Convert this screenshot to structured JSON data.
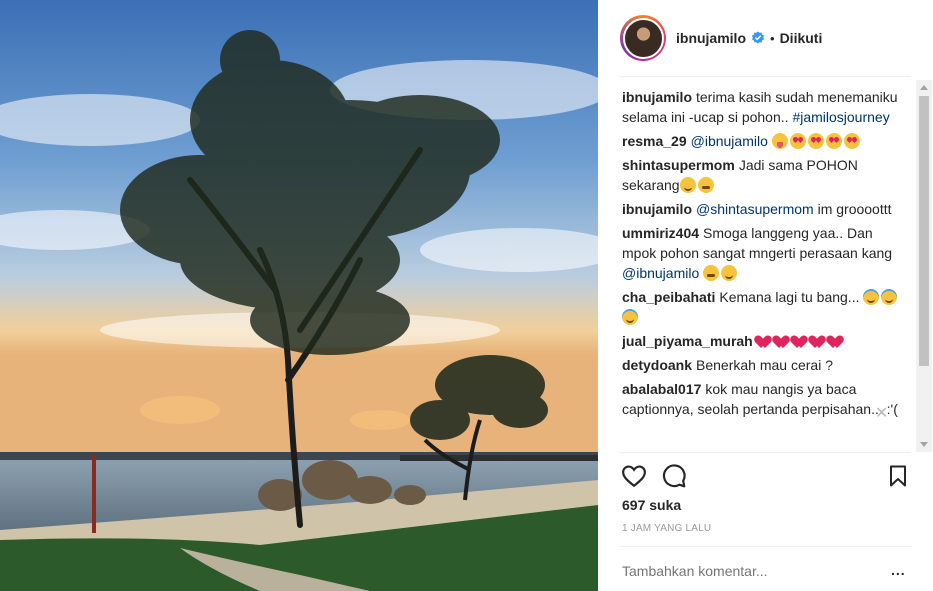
{
  "post": {
    "username": "ibnujamilo",
    "follow_state": "Diikuti",
    "likes": "697 suka",
    "timestamp": "1 JAM YANG LALU",
    "add_comment_placeholder": "Tambahkan komentar...",
    "more_label": "..."
  },
  "comments": [
    {
      "user": "ibnujamilo",
      "parts": [
        {
          "t": "text",
          "v": "terima kasih sudah menemaniku selama ini -ucap si pohon.. "
        },
        {
          "t": "tag",
          "v": "#jamilosjourney"
        }
      ]
    },
    {
      "user": "resma_29",
      "parts": [
        {
          "t": "mention",
          "v": "@ibnujamilo"
        },
        {
          "t": "text",
          "v": " "
        },
        {
          "t": "emoji",
          "v": "tongue"
        },
        {
          "t": "emoji",
          "v": "heart-eyes"
        },
        {
          "t": "emoji",
          "v": "heart-eyes"
        },
        {
          "t": "emoji",
          "v": "heart-eyes"
        },
        {
          "t": "emoji",
          "v": "heart-eyes"
        }
      ]
    },
    {
      "user": "shintasupermom",
      "parts": [
        {
          "t": "text",
          "v": "Jadi sama POHON sekarang"
        },
        {
          "t": "emoji",
          "v": "smile"
        },
        {
          "t": "emoji",
          "v": "sweat"
        }
      ]
    },
    {
      "user": "ibnujamilo",
      "parts": [
        {
          "t": "mention",
          "v": "@shintasupermom"
        },
        {
          "t": "text",
          "v": " im groooottt"
        }
      ]
    },
    {
      "user": "ummiriz404",
      "parts": [
        {
          "t": "text",
          "v": "Smoga langgeng yaa.. Dan mpok pohon sangat mngerti perasaan kang "
        },
        {
          "t": "mention",
          "v": "@ibnujamilo"
        },
        {
          "t": "text",
          "v": " "
        },
        {
          "t": "emoji",
          "v": "sweat"
        },
        {
          "t": "emoji",
          "v": "smile"
        }
      ]
    },
    {
      "user": "cha_peibahati",
      "parts": [
        {
          "t": "text",
          "v": "Kemana lagi tu bang... "
        },
        {
          "t": "emoji",
          "v": "halo"
        },
        {
          "t": "emoji",
          "v": "halo"
        },
        {
          "t": "emoji",
          "v": "halo"
        }
      ]
    },
    {
      "user": "jual_piyama_murah",
      "parts": [
        {
          "t": "emoji",
          "v": "hb"
        },
        {
          "t": "emoji",
          "v": "hb"
        },
        {
          "t": "emoji",
          "v": "hb"
        },
        {
          "t": "emoji",
          "v": "hb"
        },
        {
          "t": "emoji",
          "v": "hb"
        }
      ]
    },
    {
      "user": "detydoank",
      "parts": [
        {
          "t": "text",
          "v": "Benerkah mau cerai ?"
        }
      ]
    },
    {
      "user": "abalabal017",
      "parts": [
        {
          "t": "text",
          "v": "kok mau nangis ya baca captionnya, seolah pertanda perpisahan... :'("
        }
      ]
    }
  ],
  "icons": {
    "verified": "verified-badge-icon",
    "like": "heart-outline-icon",
    "comment": "comment-bubble-icon",
    "save": "bookmark-icon",
    "close": "close-icon"
  },
  "colors": {
    "text": "#262626",
    "muted": "#999999",
    "link": "#003569",
    "verified": "#3897f0"
  }
}
